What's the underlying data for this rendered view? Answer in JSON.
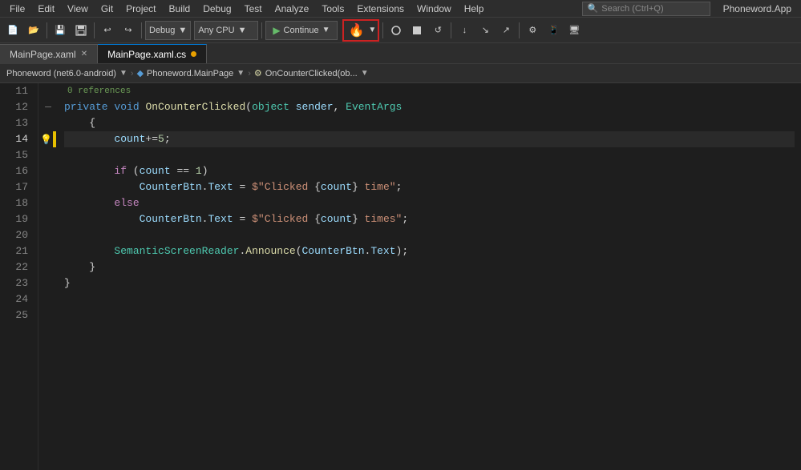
{
  "app": {
    "title": "Phoneword.App"
  },
  "menu": {
    "items": [
      "File",
      "Edit",
      "View",
      "Git",
      "Project",
      "Build",
      "Debug",
      "Test",
      "Analyze",
      "Tools",
      "Extensions",
      "Window",
      "Help"
    ]
  },
  "search": {
    "placeholder": "Search (Ctrl+Q)"
  },
  "toolbar": {
    "undo_label": "↩",
    "redo_label": "↪",
    "debug_label": "Debug",
    "cpu_label": "Any CPU",
    "continue_label": "Continue",
    "hot_reload_label": "🔥"
  },
  "tabs": [
    {
      "label": "MainPage.xaml",
      "active": false,
      "modified": false
    },
    {
      "label": "MainPage.xaml.cs",
      "active": true,
      "modified": true
    }
  ],
  "breadcrumbs": {
    "project": "Phoneword (net6.0-android)",
    "class": "Phoneword.MainPage",
    "method": "OnCounterClicked(ob..."
  },
  "code": {
    "ref_line": "0 references",
    "lines": [
      {
        "num": "11",
        "content": ""
      },
      {
        "num": "12",
        "content": "    private void OnCounterClicked(object sender, EventArgs"
      },
      {
        "num": "13",
        "content": "    {"
      },
      {
        "num": "14",
        "content": "        count+=5;"
      },
      {
        "num": "15",
        "content": ""
      },
      {
        "num": "16",
        "content": "        if (count == 1)"
      },
      {
        "num": "17",
        "content": "            CounterBtn.Text = $\"Clicked {count} time\";"
      },
      {
        "num": "18",
        "content": "        else"
      },
      {
        "num": "19",
        "content": "            CounterBtn.Text = $\"Clicked {count} times\";"
      },
      {
        "num": "20",
        "content": ""
      },
      {
        "num": "21",
        "content": "        SemanticScreenReader.Announce(CounterBtn.Text);"
      },
      {
        "num": "22",
        "content": "    }"
      },
      {
        "num": "23",
        "content": "}"
      },
      {
        "num": "24",
        "content": ""
      },
      {
        "num": "25",
        "content": ""
      }
    ]
  }
}
